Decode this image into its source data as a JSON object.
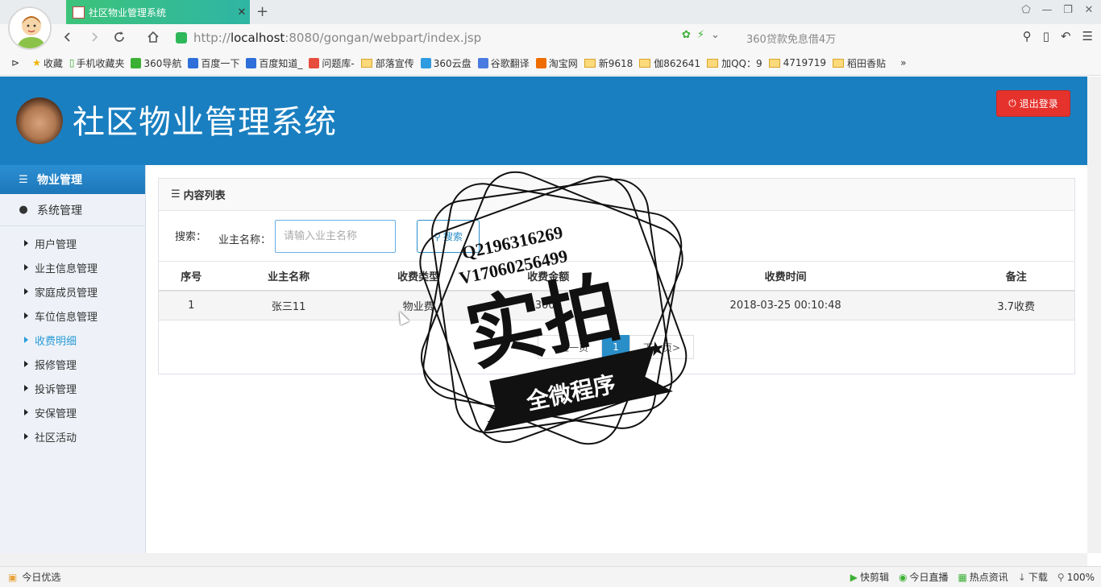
{
  "browser": {
    "tab_title": "社区物业管理系统",
    "tab_close": "✕",
    "new_tab": "+",
    "url_host": "localhost",
    "url_prefix": "http://",
    "url_path": ":8080/gongan/webpart/index.jsp",
    "search_hint": "360贷款免息借4万",
    "window_controls": [
      "⬠",
      "—",
      "❐",
      "✕"
    ],
    "bookmarks": [
      {
        "label": "收藏",
        "type": "star"
      },
      {
        "label": "手机收藏夹",
        "type": "phone"
      },
      {
        "label": "360导航",
        "type": "icon",
        "color": "#3cb034"
      },
      {
        "label": "百度一下",
        "type": "icon",
        "color": "#2f6fd9"
      },
      {
        "label": "百度知道_",
        "type": "icon",
        "color": "#2f6fd9"
      },
      {
        "label": "问题库-",
        "type": "icon",
        "color": "#e74c3c"
      },
      {
        "label": "部落宣传",
        "type": "folder"
      },
      {
        "label": "360云盘",
        "type": "icon",
        "color": "#2f9be0"
      },
      {
        "label": "谷歌翻译",
        "type": "icon",
        "color": "#4a7be0"
      },
      {
        "label": "淘宝网",
        "type": "icon",
        "color": "#ef6c00"
      },
      {
        "label": "新9618",
        "type": "folder"
      },
      {
        "label": "伽862641",
        "type": "folder"
      },
      {
        "label": "加QQ：9",
        "type": "folder"
      },
      {
        "label": "4719719",
        "type": "folder"
      },
      {
        "label": "稻田香贴",
        "type": "folder"
      }
    ],
    "bookmarks_more": "»",
    "status_left": "今日优选",
    "status_right": [
      "快剪辑",
      "今日直播",
      "热点资讯",
      "下载",
      "100%"
    ]
  },
  "app": {
    "title": "社区物业管理系统",
    "logout_label": "退出登录",
    "sidebar": {
      "property_label": "物业管理",
      "system_label": "系统管理",
      "items": [
        {
          "label": "用户管理",
          "active": false
        },
        {
          "label": "业主信息管理",
          "active": false
        },
        {
          "label": "家庭成员管理",
          "active": false
        },
        {
          "label": "车位信息管理",
          "active": false
        },
        {
          "label": "收费明细",
          "active": true
        },
        {
          "label": "报修管理",
          "active": false
        },
        {
          "label": "投诉管理",
          "active": false
        },
        {
          "label": "安保管理",
          "active": false
        },
        {
          "label": "社区活动",
          "active": false
        }
      ]
    },
    "panel": {
      "title": "内容列表",
      "search_label": "搜索：",
      "owner_label": "业主名称：",
      "owner_placeholder": "请输入业主名称",
      "search_button": "搜索"
    },
    "table": {
      "headers": [
        "序号",
        "业主名称",
        "收费类型",
        "收费金额",
        "收费时间",
        "备注"
      ],
      "rows": [
        [
          "1",
          "张三11",
          "物业费",
          "3000",
          "2018-03-25 00:10:48",
          "3.7收费"
        ]
      ]
    },
    "pager": {
      "prev": "<上一页",
      "current": "1",
      "next": "下一页>"
    }
  },
  "watermark": {
    "line1": "Q2196316269",
    "line2": "V17060256499",
    "big": "实拍",
    "banner": "全微程序"
  }
}
